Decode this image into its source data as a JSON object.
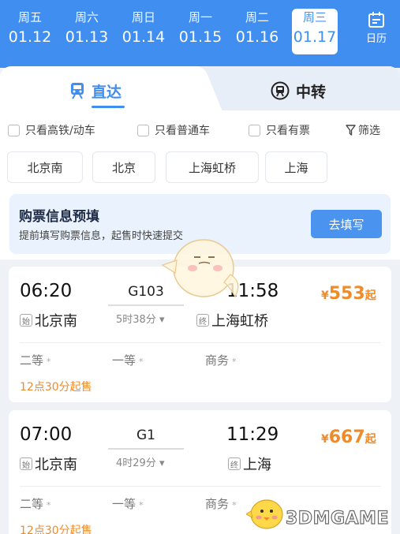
{
  "dates": [
    {
      "weekday": "周五",
      "date": "01.12"
    },
    {
      "weekday": "周六",
      "date": "01.13"
    },
    {
      "weekday": "周日",
      "date": "01.14"
    },
    {
      "weekday": "周一",
      "date": "01.15"
    },
    {
      "weekday": "周二",
      "date": "01.16"
    },
    {
      "weekday": "周三",
      "date": "01.17"
    }
  ],
  "selected_date_index": 5,
  "calendar_label": "日历",
  "tabs": {
    "direct": "直达",
    "transfer": "中转"
  },
  "filters": {
    "high_speed": "只看高铁/动车",
    "normal": "只看普通车",
    "available": "只看有票",
    "filter": "筛选"
  },
  "stations": [
    "北京南",
    "北京",
    "上海虹桥",
    "上海"
  ],
  "promo": {
    "title": "购票信息预填",
    "subtitle": "提前填写购票信息，起售时快速提交",
    "button": "去填写"
  },
  "trains": [
    {
      "depart_time": "06:20",
      "arrive_time": "11:58",
      "number": "G103",
      "duration": "5时38分",
      "from_tag": "始",
      "from": "北京南",
      "to_tag": "终",
      "to": "上海虹桥",
      "currency": "¥",
      "price": "553",
      "price_suffix": "起",
      "seats": [
        "二等",
        "一等",
        "商务"
      ],
      "seat_mark": "*",
      "sale": "12点30分起售"
    },
    {
      "depart_time": "07:00",
      "arrive_time": "11:29",
      "number": "G1",
      "duration": "4时29分",
      "from_tag": "始",
      "from": "北京南",
      "to_tag": "终",
      "to": "上海",
      "currency": "¥",
      "price": "667",
      "price_suffix": "起",
      "seats": [
        "二等",
        "一等",
        "商务"
      ],
      "seat_mark": "*",
      "sale": "12点30分起售"
    }
  ],
  "watermark": "3DMGAME",
  "colors": {
    "accent": "#3f8ef0",
    "price": "#ef8b29"
  }
}
